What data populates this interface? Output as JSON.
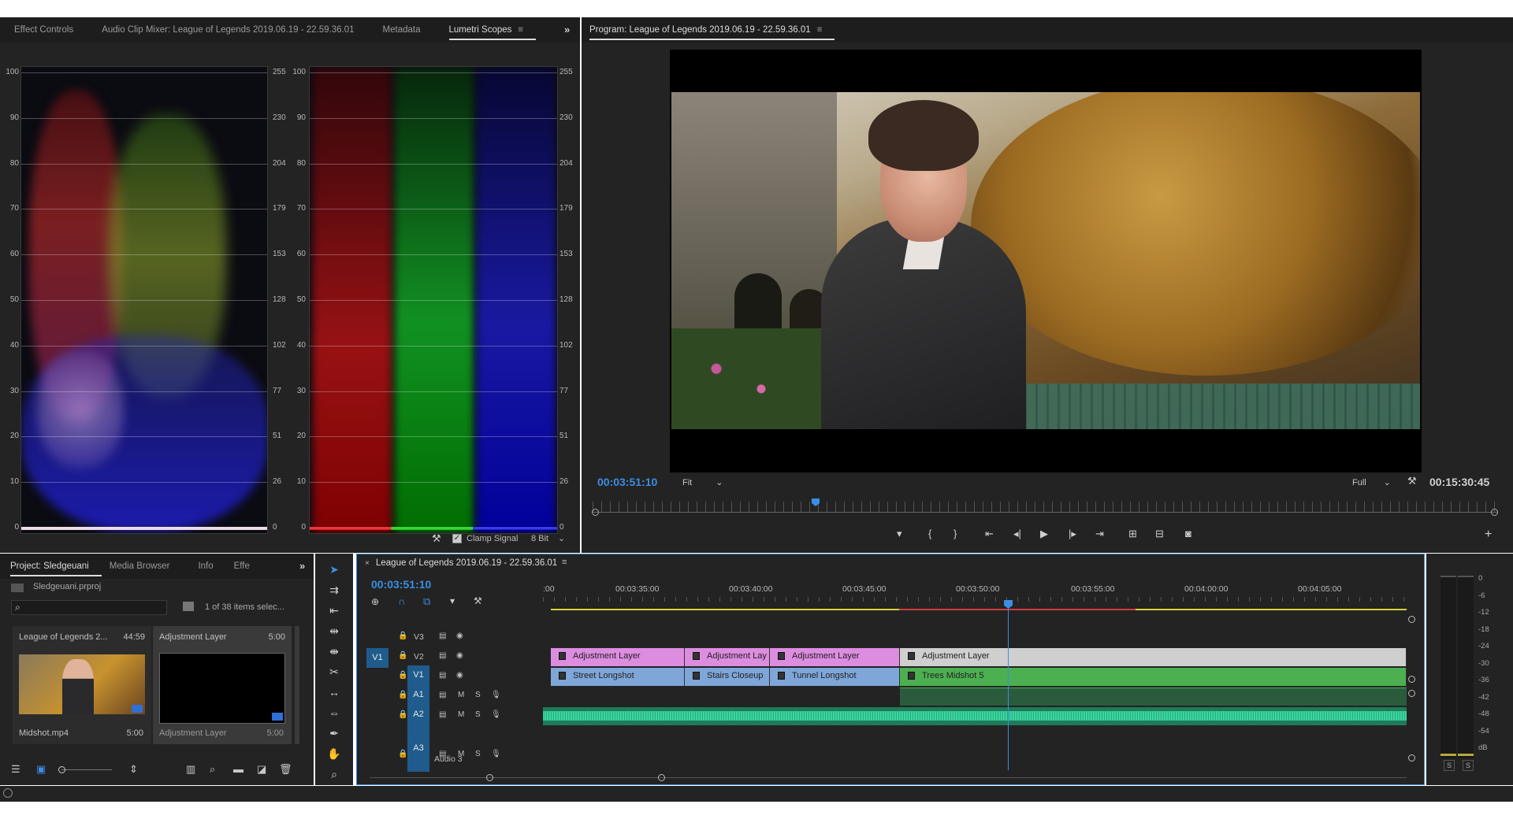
{
  "lumetri_tabs": [
    "Effect Controls",
    "Audio Clip Mixer: League of Legends 2019.06.19 - 22.59.36.01",
    "Metadata",
    "Lumetri Scopes"
  ],
  "scope_left_ticks": [
    "100",
    "90",
    "80",
    "70",
    "60",
    "50",
    "40",
    "30",
    "20",
    "10",
    "0"
  ],
  "scope_right_ticks": [
    "255",
    "230",
    "204",
    "179",
    "153",
    "128",
    "102",
    "77",
    "51",
    "26",
    "0"
  ],
  "clamp_signal_label": "Clamp Signal",
  "bit_depth": "8 Bit",
  "program": {
    "title": "Program: League of Legends 2019.06.19 - 22.59.36.01",
    "timecode": "00:03:51:10",
    "fit": "Fit",
    "quality": "Full",
    "duration": "00:15:30:45"
  },
  "project": {
    "tabs": [
      "Project: Sledgeuani",
      "Media Browser",
      "Info",
      "Effe"
    ],
    "file": "Sledgeuani.prproj",
    "selection": "1 of 38 items selec...",
    "items": [
      {
        "name": "League of Legends 2...",
        "duration": "44:59",
        "sub": "Midshot.mp4",
        "sub_duration": "5:00"
      },
      {
        "name": "Adjustment Layer",
        "duration": "5:00",
        "sub": "Adjustment Layer",
        "sub_duration": "5:00"
      }
    ]
  },
  "timeline": {
    "title": "League of Legends 2019.06.19 - 22.59.36.01",
    "timecode": "00:03:51:10",
    "ruler": [
      ":00",
      "00:03:35:00",
      "00:03:40:00",
      "00:03:45:00",
      "00:03:50:00",
      "00:03:55:00",
      "00:04:00:00",
      "00:04:05:00"
    ],
    "tracks": {
      "v3": "V3",
      "v2": "V2",
      "v1": "V1",
      "src_v1": "V1",
      "a1": "A1",
      "a2": "A2",
      "a3": "A3",
      "audio3": "Audio 3",
      "m": "M",
      "s": "S"
    },
    "v2_clips": [
      "Adjustment Layer",
      "Adjustment Lay",
      "Adjustment Layer",
      "Adjustment Layer"
    ],
    "v1_clips": [
      "Street Longshot",
      "Stairs Closeup",
      "Tunnel Longshot",
      "Trees Midshot 5"
    ]
  },
  "meter_scale": [
    "0",
    "-6",
    "-12",
    "-18",
    "-24",
    "-30",
    "-36",
    "-42",
    "-48",
    "-54",
    "dB"
  ],
  "meter_solo": [
    "S",
    "S"
  ],
  "colors": {
    "accent": "#3a8ee6",
    "adjustment_clip": "#dd8de0",
    "video_clip": "#7ea6d8",
    "trees_clip": "#4caf50",
    "audio": "#2ec38f"
  }
}
